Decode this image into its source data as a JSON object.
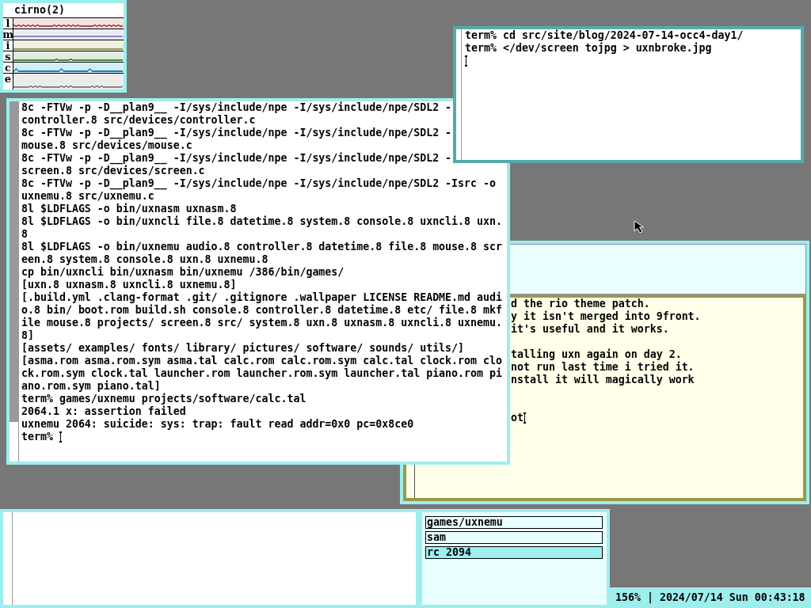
{
  "windows": [
    {
      "kind": "stats",
      "active": false,
      "title": "cirno(2)",
      "graphs": [
        {
          "label": "l",
          "color": "#b04848"
        },
        {
          "label": "m",
          "color": "#8888cc"
        },
        {
          "label": "i",
          "color": "#99994c"
        },
        {
          "label": "s",
          "color": "#448844"
        },
        {
          "label": "c",
          "color": "#0088cc"
        },
        {
          "label": "e",
          "color": "#888888"
        }
      ]
    },
    {
      "kind": "terminal",
      "active": true,
      "lines": [
        "term% cd src/site/blog/2024-07-14-occ4-day1/",
        "term% </dev/screen tojpg > uxnbroke.jpg"
      ],
      "cursor": true,
      "cursor_new_line": true
    },
    {
      "kind": "terminal",
      "active": false,
      "lines": [
        "8c -FTVw -p -D__plan9__ -I/sys/include/npe -I/sys/include/npe/SDL2 -",
        "controller.8 src/devices/controller.c",
        "8c -FTVw -p -D__plan9__ -I/sys/include/npe -I/sys/include/npe/SDL2 -",
        "mouse.8 src/devices/mouse.c",
        "8c -FTVw -p -D__plan9__ -I/sys/include/npe -I/sys/include/npe/SDL2 -",
        "screen.8 src/devices/screen.c",
        "8c -FTVw -p -D__plan9__ -I/sys/include/npe -I/sys/include/npe/SDL2 -Isrc -o",
        "uxnemu.8 src/uxnemu.c",
        "8l $LDFLAGS -o bin/uxnasm uxnasm.8",
        "8l $LDFLAGS -o bin/uxncli file.8 datetime.8 system.8 console.8 uxncli.8 uxn.",
        "8",
        "8l $LDFLAGS -o bin/uxnemu audio.8 controller.8 datetime.8 file.8 mouse.8 scr",
        "een.8 system.8 console.8 uxn.8 uxnemu.8",
        "cp bin/uxncli bin/uxnasm bin/uxnemu /386/bin/games/",
        "[uxn.8 uxnasm.8 uxncli.8 uxnemu.8]",
        "[.build.yml .clang-format .git/ .gitignore .wallpaper LICENSE README.md audi",
        "o.8 bin/ boot.rom build.sh console.8 controller.8 datetime.8 etc/ file.8 mkf",
        "ile mouse.8 projects/ screen.8 src/ system.8 uxn.8 uxnasm.8 uxncli.8 uxnemu.",
        "8]",
        "[assets/ examples/ fonts/ library/ pictures/ software/ sounds/ utils/]",
        "[asma.rom asma.rom.sym asma.tal calc.rom calc.rom.sym calc.tal clock.rom clo",
        "ck.rom.sym clock.tal launcher.rom launcher.rom.sym launcher.tal piano.rom pi",
        "ano.rom.sym piano.tal]",
        "term% games/uxnemu projects/software/calc.tal",
        "2064.1 x: assertion failed",
        "uxnemu 2064: suicide: sys: trap: fault read addr=0x0 pc=0x8ce0",
        "term% "
      ],
      "cursor": true
    },
    {
      "kind": "sam",
      "active": false,
      "lines": [
        {
          "kind": "text",
          "text": "d the rio theme patch."
        },
        {
          "kind": "text",
          "text": "y it isn't merged into 9front."
        },
        {
          "kind": "text",
          "text": "it's useful and it works."
        },
        {
          "kind": "blank"
        },
        {
          "kind": "text",
          "text": "talling uxn again on day 2."
        },
        {
          "kind": "text",
          "text": "not run last time i tried it."
        },
        {
          "kind": "text",
          "text": "nstall it will magically work"
        },
        {
          "kind": "blank"
        },
        {
          "kind": "blank"
        },
        {
          "kind": "text",
          "text": "ot"
        }
      ],
      "cursor": true
    },
    {
      "kind": "terminal",
      "active": false
    },
    {
      "kind": "window_list",
      "active": false,
      "items": [
        {
          "label": "games/uxnemu",
          "selected": false
        },
        {
          "label": "sam",
          "selected": false
        },
        {
          "label": "rc 2094",
          "selected": true
        }
      ]
    }
  ],
  "status_bar": {
    "text": "156% | 2024/07/14 Sun 00:43:18"
  }
}
